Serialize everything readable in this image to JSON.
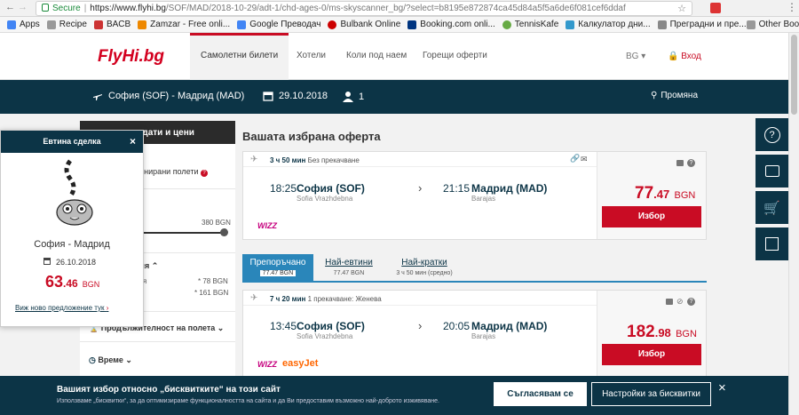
{
  "browser": {
    "secure_label": "Secure",
    "url_host": "https://www.flyhi.bg",
    "url_path": "/SOF/MAD/2018-10-29/adt-1/chd-ages-0/ms-skyscanner_bg/?select=b8195e872874ca45d84a5f5a6de6f081cef6ddaf",
    "bookmarks": [
      "Apps",
      "Recipe",
      "BACB",
      "Zamzar - Free onli...",
      "Google Преводач",
      "Bulbank Online",
      "Booking.com onli...",
      "TennisKafe",
      "Калкулатор дни...",
      "Преградни и пре...",
      "Other Bookmarks"
    ]
  },
  "header": {
    "logo": "FlyHi.bg",
    "nav": [
      "Самолетни билети",
      "Хотели",
      "Коли под наем",
      "Горещи оферти"
    ],
    "lang": "BG",
    "login": "Вход"
  },
  "search": {
    "route": "София (SOF) - Мадрид (MAD)",
    "date": "29.10.2018",
    "passengers": "1",
    "change": "Промяна"
  },
  "left": {
    "tab_label": "е дати и цени",
    "combined": "бинирани полети",
    "price_max": "380 BGN",
    "section_airline": "ния",
    "airline_1_name": "ния",
    "airline_1_price": "* 78 BGN",
    "airline_2_name": "е",
    "airline_2_price": "* 161 BGN",
    "duration": "Продължителност на полета",
    "time": "Време"
  },
  "main": {
    "title": "Вашата избрана оферта",
    "offer1": {
      "duration": "3 ч 50 мин",
      "stops": "Без прекачване",
      "dep_time": "18:25",
      "dep_city": "София (SOF)",
      "dep_airport": "Sofia Vrazhdebna",
      "arr_time": "21:15",
      "arr_city": "Мадрид (MAD)",
      "arr_airport": "Barajas",
      "airline": "WIZZ",
      "price_int": "77",
      "price_dec": ".47",
      "currency": "BGN",
      "button": "Избор"
    },
    "tabs": [
      {
        "label": "Препоръчано",
        "sub": "77.47 BGN"
      },
      {
        "label": "Най-евтини",
        "sub": "77.47 BGN"
      },
      {
        "label": "Най-кратки",
        "sub": "3 ч 50 мин (средно)"
      }
    ],
    "offer2": {
      "duration": "7 ч 20 мин",
      "stops": "1 прекачване: Женева",
      "dep_time": "13:45",
      "dep_city": "София (SOF)",
      "dep_airport": "Sofia Vrazhdebna",
      "arr_time": "20:05",
      "arr_city": "Мадрид (MAD)",
      "arr_airport": "Barajas",
      "airline_1": "WIZZ",
      "airline_2": "easyJet",
      "price_int": "182",
      "price_dec": ".98",
      "currency": "BGN",
      "button": "Избор"
    }
  },
  "deal": {
    "title": "Евтина сделка",
    "route": "София - Мадрид",
    "date": "26.10.2018",
    "price_int": "63",
    "price_dec": ".46",
    "currency": "BGN",
    "link": "Виж ново предложение тук"
  },
  "cookie": {
    "title": "Вашият избор относно „бисквитките“ на този сайт",
    "text": "Използваме „бисквитки“, за да оптимизираме функционалността на сайта и да Ви предоставим възможно най-доброто изживяване.",
    "accept": "Съгласявам се",
    "settings": "Настройки за бисквитки"
  },
  "colors": {
    "accent": "#c90c24",
    "navy": "#0c3446"
  }
}
